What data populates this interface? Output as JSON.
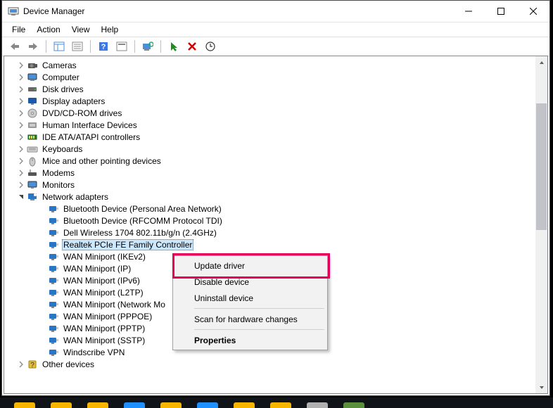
{
  "window": {
    "title": "Device Manager",
    "menu": {
      "file": "File",
      "action": "Action",
      "view": "View",
      "help": "Help"
    }
  },
  "tree": {
    "items": [
      {
        "label": "Cameras",
        "expanded": false,
        "depth": 1,
        "icon": "camera"
      },
      {
        "label": "Computer",
        "expanded": false,
        "depth": 1,
        "icon": "computer"
      },
      {
        "label": "Disk drives",
        "expanded": false,
        "depth": 1,
        "icon": "disk"
      },
      {
        "label": "Display adapters",
        "expanded": false,
        "depth": 1,
        "icon": "display"
      },
      {
        "label": "DVD/CD-ROM drives",
        "expanded": false,
        "depth": 1,
        "icon": "dvd"
      },
      {
        "label": "Human Interface Devices",
        "expanded": false,
        "depth": 1,
        "icon": "hid"
      },
      {
        "label": "IDE ATA/ATAPI controllers",
        "expanded": false,
        "depth": 1,
        "icon": "ide"
      },
      {
        "label": "Keyboards",
        "expanded": false,
        "depth": 1,
        "icon": "keyboard"
      },
      {
        "label": "Mice and other pointing devices",
        "expanded": false,
        "depth": 1,
        "icon": "mouse"
      },
      {
        "label": "Modems",
        "expanded": false,
        "depth": 1,
        "icon": "modem"
      },
      {
        "label": "Monitors",
        "expanded": false,
        "depth": 1,
        "icon": "monitor"
      },
      {
        "label": "Network adapters",
        "expanded": true,
        "depth": 1,
        "icon": "network"
      },
      {
        "label": "Bluetooth Device (Personal Area Network)",
        "depth": 2,
        "icon": "netadapter"
      },
      {
        "label": "Bluetooth Device (RFCOMM Protocol TDI)",
        "depth": 2,
        "icon": "netadapter"
      },
      {
        "label": "Dell Wireless 1704 802.11b/g/n (2.4GHz)",
        "depth": 2,
        "icon": "netadapter"
      },
      {
        "label": "Realtek PCIe FE Family Controller",
        "depth": 2,
        "icon": "netadapter",
        "selected": true
      },
      {
        "label": "WAN Miniport (IKEv2)",
        "depth": 2,
        "icon": "netadapter"
      },
      {
        "label": "WAN Miniport (IP)",
        "depth": 2,
        "icon": "netadapter"
      },
      {
        "label": "WAN Miniport (IPv6)",
        "depth": 2,
        "icon": "netadapter"
      },
      {
        "label": "WAN Miniport (L2TP)",
        "depth": 2,
        "icon": "netadapter"
      },
      {
        "label": "WAN Miniport (Network Mo",
        "depth": 2,
        "icon": "netadapter"
      },
      {
        "label": "WAN Miniport (PPPOE)",
        "depth": 2,
        "icon": "netadapter"
      },
      {
        "label": "WAN Miniport (PPTP)",
        "depth": 2,
        "icon": "netadapter"
      },
      {
        "label": "WAN Miniport (SSTP)",
        "depth": 2,
        "icon": "netadapter"
      },
      {
        "label": "Windscribe VPN",
        "depth": 2,
        "icon": "netadapter"
      },
      {
        "label": "Other devices",
        "expanded": false,
        "depth": 1,
        "icon": "other"
      }
    ]
  },
  "context_menu": {
    "update": "Update driver",
    "disable": "Disable device",
    "uninstall": "Uninstall device",
    "scan": "Scan for hardware changes",
    "properties": "Properties"
  }
}
